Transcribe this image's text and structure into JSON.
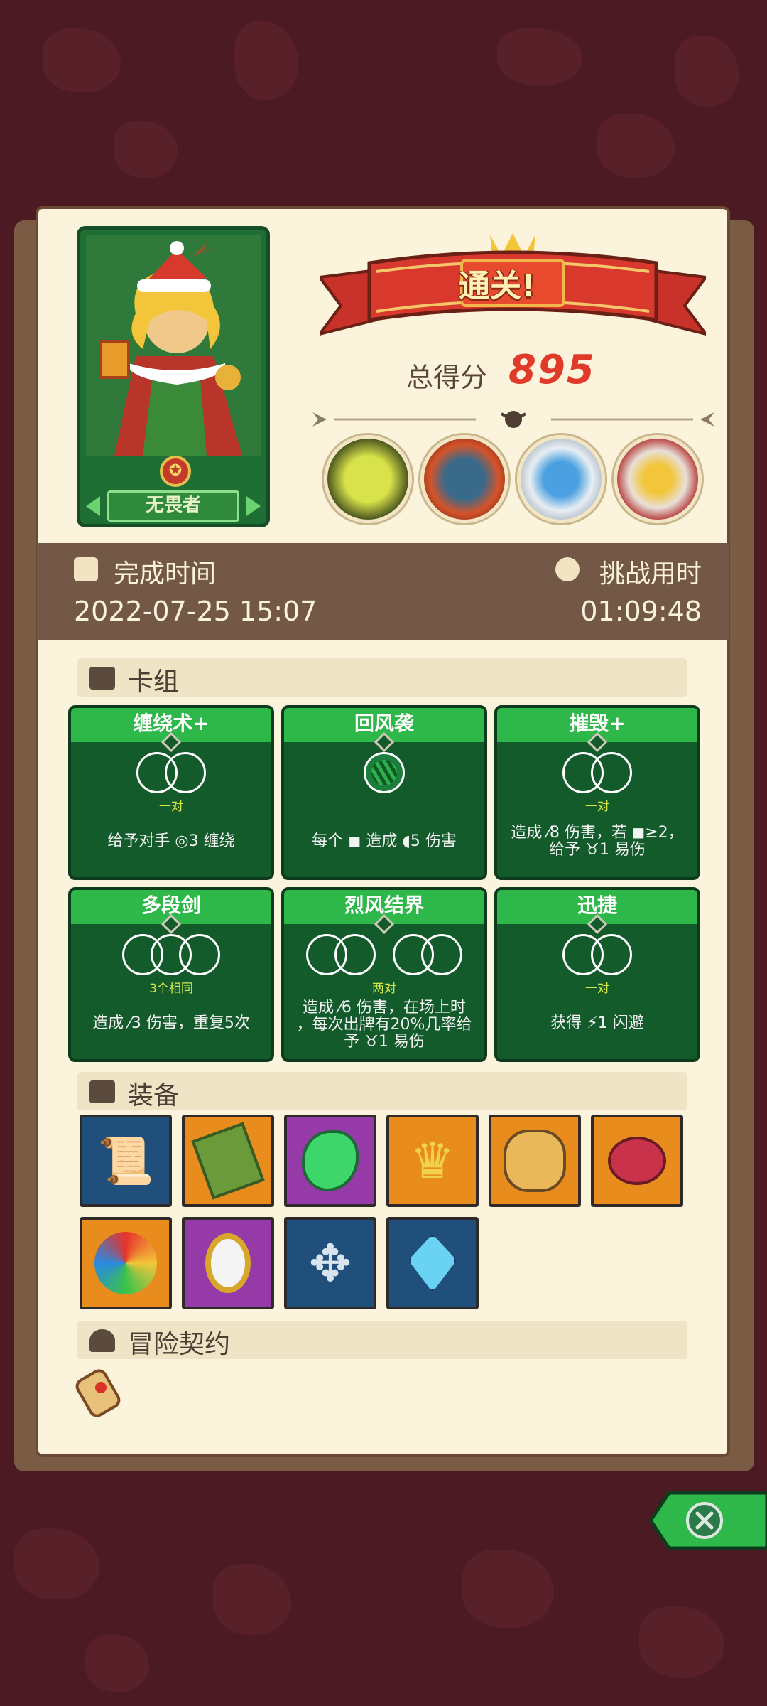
{
  "hero": {
    "name": "无畏者"
  },
  "banner": {
    "title": "通关!"
  },
  "score": {
    "label": "总得分",
    "value": "895"
  },
  "time": {
    "finish_label": "完成时间",
    "finish_value": "2022-07-25 15:07",
    "duration_label": "挑战用时",
    "duration_value": "01:09:48"
  },
  "bosses": [
    "skeleton-dragon-boss",
    "orc-warrior-boss",
    "yeti-boss",
    "bone-king-boss"
  ],
  "sections": {
    "deck": "卡组",
    "equipment": "装备",
    "contract": "冒险契约"
  },
  "cards": [
    {
      "title": "缠绕术+",
      "requirement": "一对",
      "desc_line1": "给予对手 ◎3 缠绕",
      "desc_line2": "",
      "desc_line3": "",
      "circles": 2,
      "rarity": "silver"
    },
    {
      "title": "回风袭",
      "requirement": "",
      "desc_line1": "每个 ◼ 造成 ◖5 伤害",
      "desc_line2": "",
      "desc_line3": "",
      "circles": 1,
      "rarity": "gold"
    },
    {
      "title": "摧毁+",
      "requirement": "一对",
      "desc_line1": "造成 ⁄8 伤害，若 ◼≥2，",
      "desc_line2": "给予 ♉1 易伤",
      "desc_line3": "",
      "circles": 2,
      "rarity": "silver"
    },
    {
      "title": "多段剑",
      "requirement": "3个相同",
      "desc_line1": "造成 ⁄3 伤害，重复5次",
      "desc_line2": "",
      "desc_line3": "",
      "circles": 3,
      "rarity": "gold"
    },
    {
      "title": "烈风结界",
      "requirement": "两对",
      "desc_line1": "造成 ⁄6 伤害，在场上时",
      "desc_line2": "，每次出牌有20%几率给",
      "desc_line3": "予 ♉1 易伤",
      "circles": 4,
      "rarity": "silver"
    },
    {
      "title": "迅捷",
      "requirement": "一对",
      "desc_line1": "获得 ⚡1 闪避",
      "desc_line2": "",
      "desc_line3": "",
      "circles": 2,
      "rarity": "silver"
    }
  ],
  "items": [
    {
      "icon": "scroll-snowflake-icon",
      "color": "blue"
    },
    {
      "icon": "moss-book-icon",
      "color": "orange"
    },
    {
      "icon": "green-leaf-gem-icon",
      "color": "purple"
    },
    {
      "icon": "gold-crown-icon",
      "color": "orange"
    },
    {
      "icon": "treasure-sack-icon",
      "color": "orange"
    },
    {
      "icon": "ham-leg-icon",
      "color": "orange"
    },
    {
      "icon": "rainbow-swirl-icon",
      "color": "orange"
    },
    {
      "icon": "gold-mirror-icon",
      "color": "purple"
    },
    {
      "icon": "silver-emblem-icon",
      "color": "blue"
    },
    {
      "icon": "blue-crystal-icon",
      "color": "blue"
    }
  ],
  "colors": {
    "card_green": "#145b2c",
    "header_green": "#2fb84a",
    "score_red": "#e03a2a",
    "band_brown": "#745847"
  }
}
